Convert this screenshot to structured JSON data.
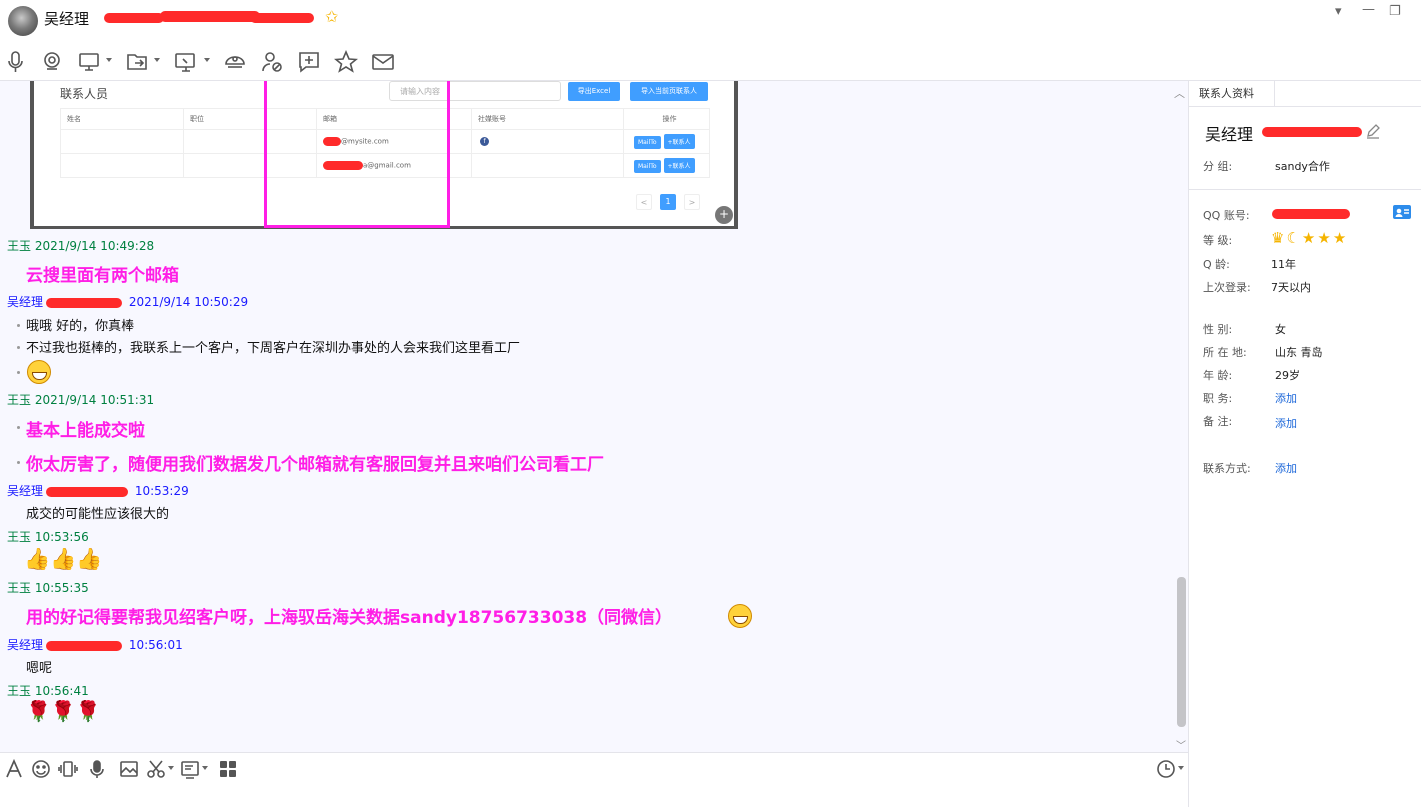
{
  "window": {
    "title_name": "吴经理"
  },
  "toolbar": {
    "icons": [
      "microphone-icon",
      "video-icon",
      "screen-share-icon",
      "file-transfer-icon",
      "remote-desktop-icon",
      "app-icon",
      "remove-contact-icon",
      "add-comment-icon",
      "favorite-icon",
      "mail-icon"
    ]
  },
  "embed": {
    "title": "联系人员",
    "search_placeholder": "请输入内容",
    "export_btn": "导出Excel",
    "import_btn": "导入当前页联系人",
    "headers": [
      "姓名",
      "职位",
      "邮箱",
      "社媒账号",
      "操作"
    ],
    "row1_email": "@mysite.com",
    "row2_email": "a@gmail.com",
    "fb": "f",
    "mailto": "MailTo",
    "add_contact": "+联系人",
    "page_current": "1",
    "page_prev": "<",
    "page_next": ">"
  },
  "messages": {
    "m1_sender": "王玉",
    "m1_time": "2021/9/14 10:49:28",
    "m1_text": "云搜里面有两个邮箱",
    "m2_sender": "吴经理",
    "m2_time": "2021/9/14 10:50:29",
    "m2_line1": "哦哦  好的，你真棒",
    "m2_line2": "不过我也挺棒的，我联系上一个客户，下周客户在深圳办事处的人会来我们这里看工厂",
    "m3_sender": "王玉",
    "m3_time": "2021/9/14 10:51:31",
    "m3_line1": "基本上能成交啦",
    "m3_line2": "你太厉害了，随便用我们数据发几个邮箱就有客服回复并且来咱们公司看工厂",
    "m4_sender": "吴经理",
    "m4_time": "10:53:29",
    "m4_text": "成交的可能性应该很大的",
    "m5_sender": "王玉",
    "m5_time": "10:53:56",
    "m5_text": "👍👍👍",
    "m6_sender": "王玉",
    "m6_time": "10:55:35",
    "m6_text": "用的好记得要帮我见绍客户呀，上海驭岳海关数据sandy18756733038（同微信）",
    "m7_sender": "吴经理",
    "m7_time": "10:56:01",
    "m7_text": "嗯呢",
    "m8_sender": "王玉",
    "m8_time": "10:56:41",
    "m8_text": "🌹🌹🌹"
  },
  "panel": {
    "tab": "联系人资料",
    "name": "吴经理",
    "group_label": "分      组:",
    "group_value": "sandy合作",
    "qq_label": "QQ   账号:",
    "level_label": "等      级:",
    "age_q_label": "Q      龄:",
    "age_q_value": "11年",
    "last_login_label": "上次登录:",
    "last_login_value": "7天以内",
    "gender_label": "性      别:",
    "gender_value": "女",
    "location_label": "所 在 地:",
    "location_value": "山东 青岛",
    "age_label": "年      龄:",
    "age_value": "29岁",
    "job_label": "职      务:",
    "job_value": "添加",
    "note_label": "备      注:",
    "note_value": "添加",
    "contact_label": "联系方式:",
    "contact_value": "添加"
  },
  "colors": {
    "accent_magenta": "#ff1ee6",
    "self_name": "#008040",
    "other_name": "#1a1aff",
    "link": "#1a66d9",
    "redaction": "#ff2a2a"
  }
}
